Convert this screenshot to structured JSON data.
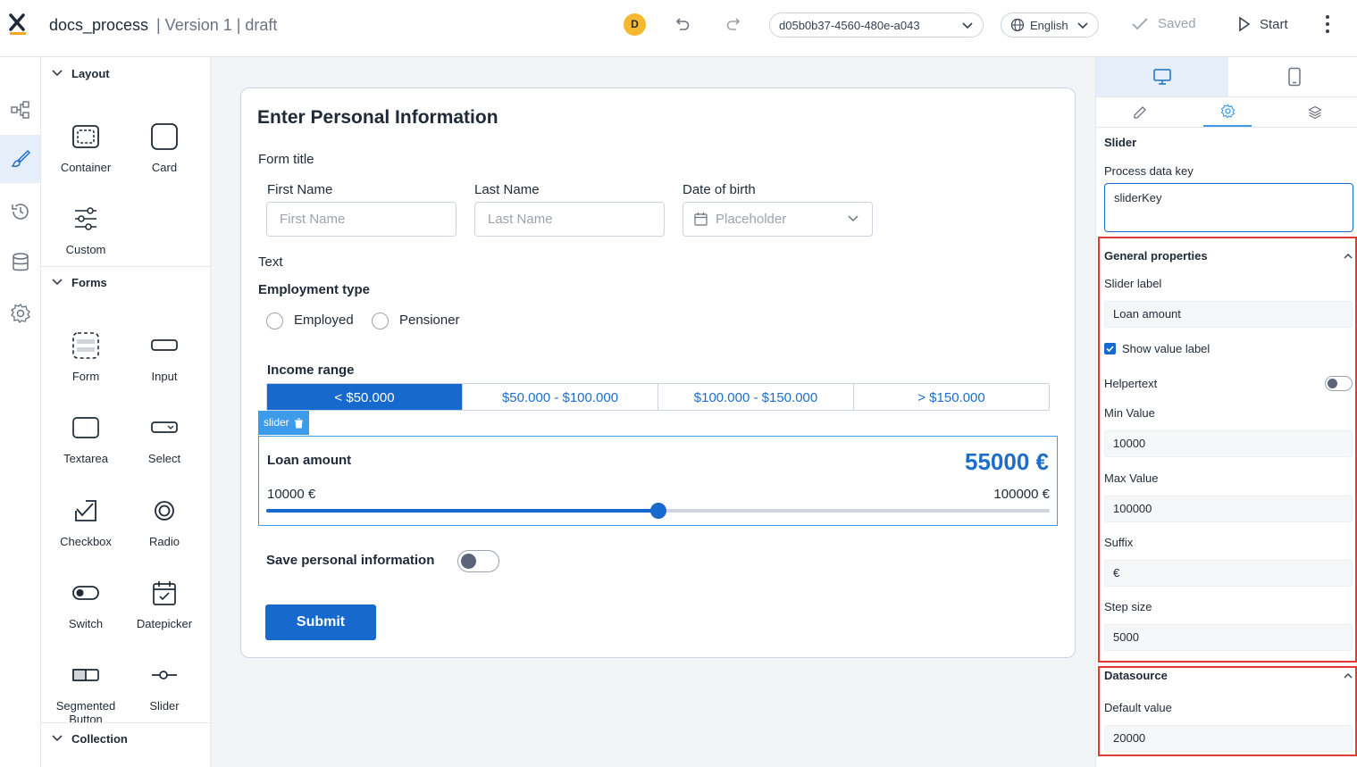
{
  "header": {
    "app_name": "docs_process",
    "meta": "| Version 1 | draft",
    "avatar_initial": "D",
    "process_id": "d05b0b37-4560-480e-a043",
    "language": "English",
    "saved_label": "Saved",
    "start_label": "Start"
  },
  "palette": {
    "layout_heading": "Layout",
    "forms_heading": "Forms",
    "collection_heading": "Collection",
    "layout_items": [
      "Container",
      "Card",
      "Custom"
    ],
    "forms_items": [
      "Form",
      "Input",
      "Textarea",
      "Select",
      "Checkbox",
      "Radio",
      "Switch",
      "Datepicker",
      "Segmented Button",
      "Slider"
    ]
  },
  "form": {
    "title": "Enter Personal Information",
    "subtitle": "Form title",
    "first_name_label": "First Name",
    "first_name_placeholder": "First Name",
    "last_name_label": "Last Name",
    "last_name_placeholder": "Last Name",
    "dob_label": "Date of birth",
    "dob_placeholder": "Placeholder",
    "text_label": "Text",
    "employment_label": "Employment type",
    "employment_options": [
      "Employed",
      "Pensioner"
    ],
    "income_label": "Income range",
    "income_options": [
      "< $50.000",
      "$50.000 - $100.000",
      "$100.000 - $150.000",
      "> $150.000"
    ],
    "income_selected_index": 0,
    "slider_tag": "slider",
    "slider_label": "Loan amount",
    "slider_value_display": "55000 €",
    "slider_min_display": "10000 €",
    "slider_max_display": "100000 €",
    "slider_min": 10000,
    "slider_max": 100000,
    "slider_value": 55000,
    "save_info_label": "Save personal information",
    "save_info_on": false,
    "submit_label": "Submit"
  },
  "properties": {
    "component_title": "Slider",
    "process_data_key_label": "Process data key",
    "process_data_key_value": "sliderKey",
    "general_heading": "General properties",
    "slider_label_label": "Slider label",
    "slider_label_value": "Loan amount",
    "show_value_label": "Show value label",
    "show_value_checked": true,
    "helpertext_label": "Helpertext",
    "helpertext_on": false,
    "min_label": "Min Value",
    "min_value": "10000",
    "max_label": "Max Value",
    "max_value": "100000",
    "suffix_label": "Suffix",
    "suffix_value": "€",
    "step_label": "Step size",
    "step_value": "5000",
    "datasource_heading": "Datasource",
    "default_label": "Default value",
    "default_value": "20000"
  },
  "colors": {
    "accent": "#1769cd",
    "selection_outline": "#3d9be9",
    "highlight_box": "#e53935",
    "avatar": "#f5b82e"
  }
}
